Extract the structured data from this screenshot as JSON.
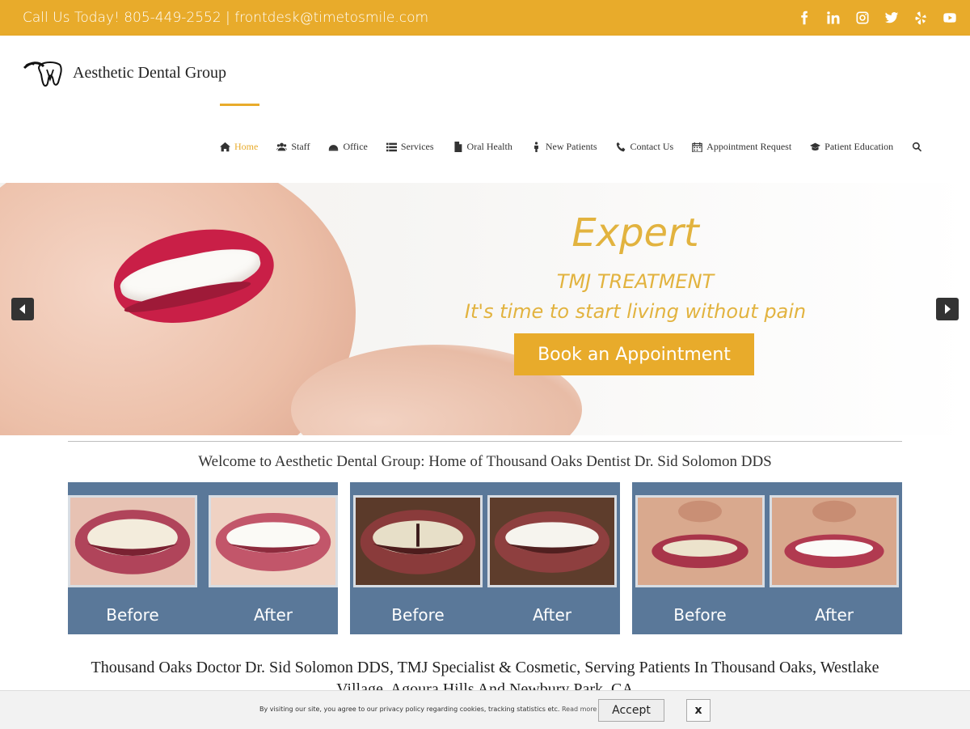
{
  "topbar": {
    "contact": "Call Us Today! 805-449-2552 | frontdesk@timetosmile.com",
    "social_icons": [
      "facebook-icon",
      "linkedin-icon",
      "instagram-icon",
      "twitter-icon",
      "yelp-icon",
      "youtube-icon"
    ]
  },
  "header": {
    "logo_name": "Aesthetic Dental Group",
    "nav": [
      {
        "label": "Home",
        "icon": "home-icon",
        "active": true
      },
      {
        "label": "Staff",
        "icon": "users-icon"
      },
      {
        "label": "Office",
        "icon": "office-icon"
      },
      {
        "label": "Services",
        "icon": "list-icon"
      },
      {
        "label": "Oral Health",
        "icon": "document-icon"
      },
      {
        "label": "New Patients",
        "icon": "person-icon"
      },
      {
        "label": "Contact Us",
        "icon": "phone-icon"
      },
      {
        "label": "Appointment Request",
        "icon": "calendar-icon"
      },
      {
        "label": "Patient Education",
        "icon": "graduation-cap-icon"
      }
    ]
  },
  "hero": {
    "headline": "Expert",
    "subheadline": "TMJ TREATMENT",
    "tagline": "It's time to start living without pain",
    "button": "Book an Appointment"
  },
  "welcome": "Welcome to Aesthetic Dental Group: Home of Thousand Oaks Dentist Dr. Sid Solomon DDS",
  "panels": [
    {
      "before": "Before",
      "after": "After"
    },
    {
      "before": "Before",
      "after": "After"
    },
    {
      "before": "Before",
      "after": "After"
    }
  ],
  "intro_heading": "Thousand Oaks Doctor Dr. Sid Solomon DDS, TMJ Specialist & Cosmetic, Serving Patients In Thousand Oaks, Westlake Village, Agoura Hills And Newbury Park, CA",
  "cookie": {
    "message": "By visiting our site, you agree to our privacy policy regarding cookies, tracking statistics etc.",
    "read_more": "Read more",
    "accept": "Accept",
    "close": "x"
  },
  "colors": {
    "accent": "#e8ab2b",
    "panel": "#5a7899",
    "hero_text": "#e2b33f"
  }
}
